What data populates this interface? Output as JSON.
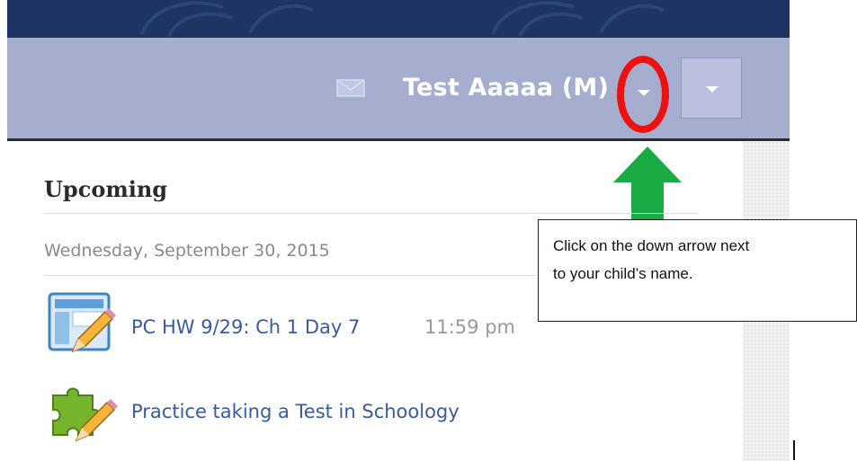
{
  "header": {
    "user_name": "Test Aaaaa (M)",
    "mail_icon": "envelope-icon",
    "caret_icon": "chevron-down-icon",
    "menu_icon": "chevron-down-icon"
  },
  "colors": {
    "banner": "#1e3463",
    "topbar": "#a6aed0",
    "link": "#3a5a9c",
    "annotation_circle": "#ee1111",
    "annotation_arrow": "#1aab44"
  },
  "upcoming": {
    "title": "Upcoming",
    "date": "Wednesday, September 30, 2015",
    "items": [
      {
        "title": "PC HW 9/29: Ch 1 Day 7",
        "time": "11:59 pm",
        "icon": "assignment-icon"
      },
      {
        "title": "Practice taking a Test in Schoology",
        "icon": "puzzle-test-icon"
      }
    ]
  },
  "callout": {
    "line1": "Click on the down arrow next",
    "line2": "to your child’s name."
  }
}
